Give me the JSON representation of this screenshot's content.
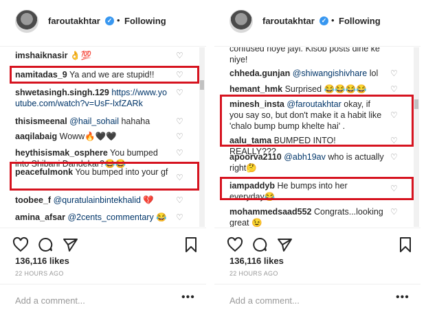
{
  "accent": "#3897f0",
  "highlight_color": "#d6131f",
  "left": {
    "header": {
      "username": "faroutakhtar",
      "dot": "•",
      "follow": "Following"
    },
    "comments": [
      {
        "user": "imshaiknasir",
        "text": "👌💯"
      },
      {
        "user": "namitadas_9",
        "text": "Ya and we are stupid!!"
      },
      {
        "user": "shwetasingh.singh.129",
        "text": "https://www.youtube.com/watch?v=UsF-lxfZARk"
      },
      {
        "user": "thisismeenal",
        "mention": "@hail_sohail",
        "text": "hahaha"
      },
      {
        "user": "aaqilabaig",
        "text": "Woww🔥🖤🖤"
      },
      {
        "user": "heythisismak_osphere",
        "text": "You bumped into Shibani Dandekar?😂😂"
      },
      {
        "user": "peacefulmonk",
        "text": "You bumped into your gf"
      },
      {
        "user": "toobee_f",
        "mention": "@quratulainbintekhalid",
        "text": "💔"
      },
      {
        "user": "amina_afsar",
        "mention": "@2cents_commentary",
        "text": "😂"
      }
    ],
    "likes": "136,116 likes",
    "time": "22 HOURS AGO",
    "add_comment_placeholder": "Add a comment...",
    "more": "•••"
  },
  "right": {
    "header": {
      "username": "faroutakhtar",
      "dot": "•",
      "follow": "Following"
    },
    "comments": [
      {
        "user": "",
        "text": "confused hoye jayi. Kisob posts dine ke niye!"
      },
      {
        "user": "chheda.gunjan",
        "mention": "@shiwangishivhare",
        "text": "lol"
      },
      {
        "user": "hemant_hmk",
        "text": "Surprised 😂😂😂😂"
      },
      {
        "user": "minesh_insta",
        "mention": "@faroutakhtar",
        "text": "okay, if you say so, but don't make it a habit like 'chalo bump bump khelte hai' ."
      },
      {
        "user": "aalu_tama",
        "text": "BUMPED INTO! REALLY???"
      },
      {
        "user": "apoorva2110",
        "mention": "@abh19av",
        "text": "who is actually right🤔"
      },
      {
        "user": "iampaddyb",
        "text": "He bumps into her everyday😂"
      },
      {
        "user": "mohammedsaad552",
        "text": "Congrats...looking great 😉"
      }
    ],
    "likes": "136,116 likes",
    "time": "22 HOURS AGO",
    "add_comment_placeholder": "Add a comment...",
    "more": "•••"
  }
}
